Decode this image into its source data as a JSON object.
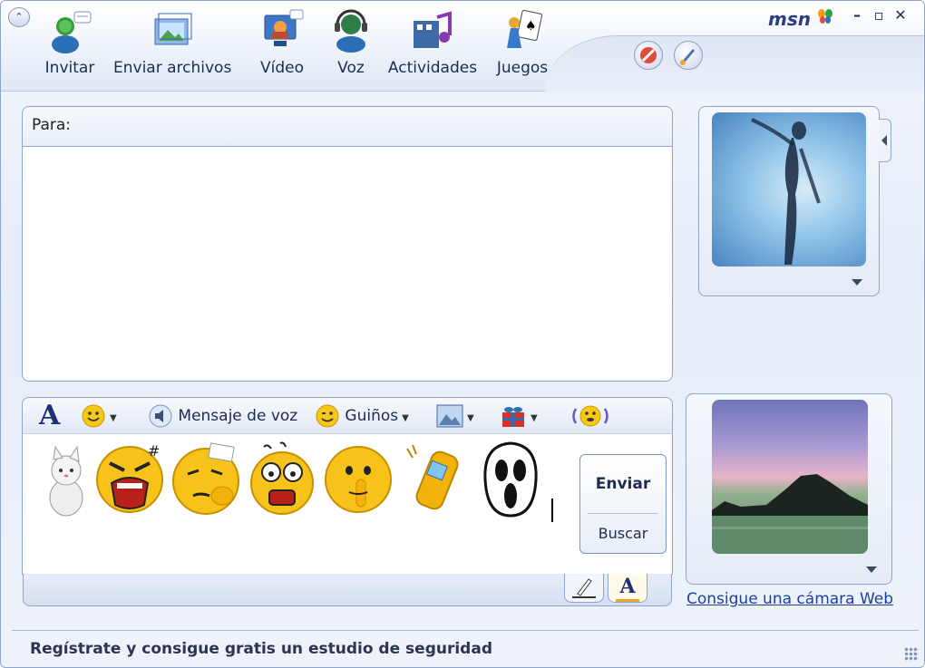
{
  "toolbar": {
    "items": [
      {
        "label": "Invitar",
        "icon": "invite-contact-icon"
      },
      {
        "label": "Enviar archivos",
        "icon": "send-files-icon"
      },
      {
        "label": "Vídeo",
        "icon": "video-icon"
      },
      {
        "label": "Voz",
        "icon": "voice-icon"
      },
      {
        "label": "Actividades",
        "icon": "activities-icon"
      },
      {
        "label": "Juegos",
        "icon": "games-icon"
      }
    ],
    "logo": "msn",
    "block_icon": "block-icon",
    "background_icon": "paint-brush-icon"
  },
  "conversation": {
    "to_label": "Para:",
    "history": ""
  },
  "format_bar": {
    "font_icon": "font-A-icon",
    "emoticon_icon": "smiley-icon",
    "voice_message": "Mensaje de voz",
    "winks": "Guiños",
    "background_icon": "picture-icon",
    "gift_icon": "gift-icon",
    "nudge_icon": "nudge-icon"
  },
  "emoticons": [
    "cat",
    "angry",
    "thinking",
    "scared",
    "shh",
    "phone",
    "scream"
  ],
  "buttons": {
    "send": "Enviar",
    "search": "Buscar"
  },
  "sidebar": {
    "webcam_link": "Consigue una cámara Web"
  },
  "status": {
    "message": "Regístrate y consigue gratis un estudio de seguridad"
  },
  "colors": {
    "border": "#8ea6cc",
    "text": "#1d2c4f",
    "link": "#1e3f9a"
  }
}
